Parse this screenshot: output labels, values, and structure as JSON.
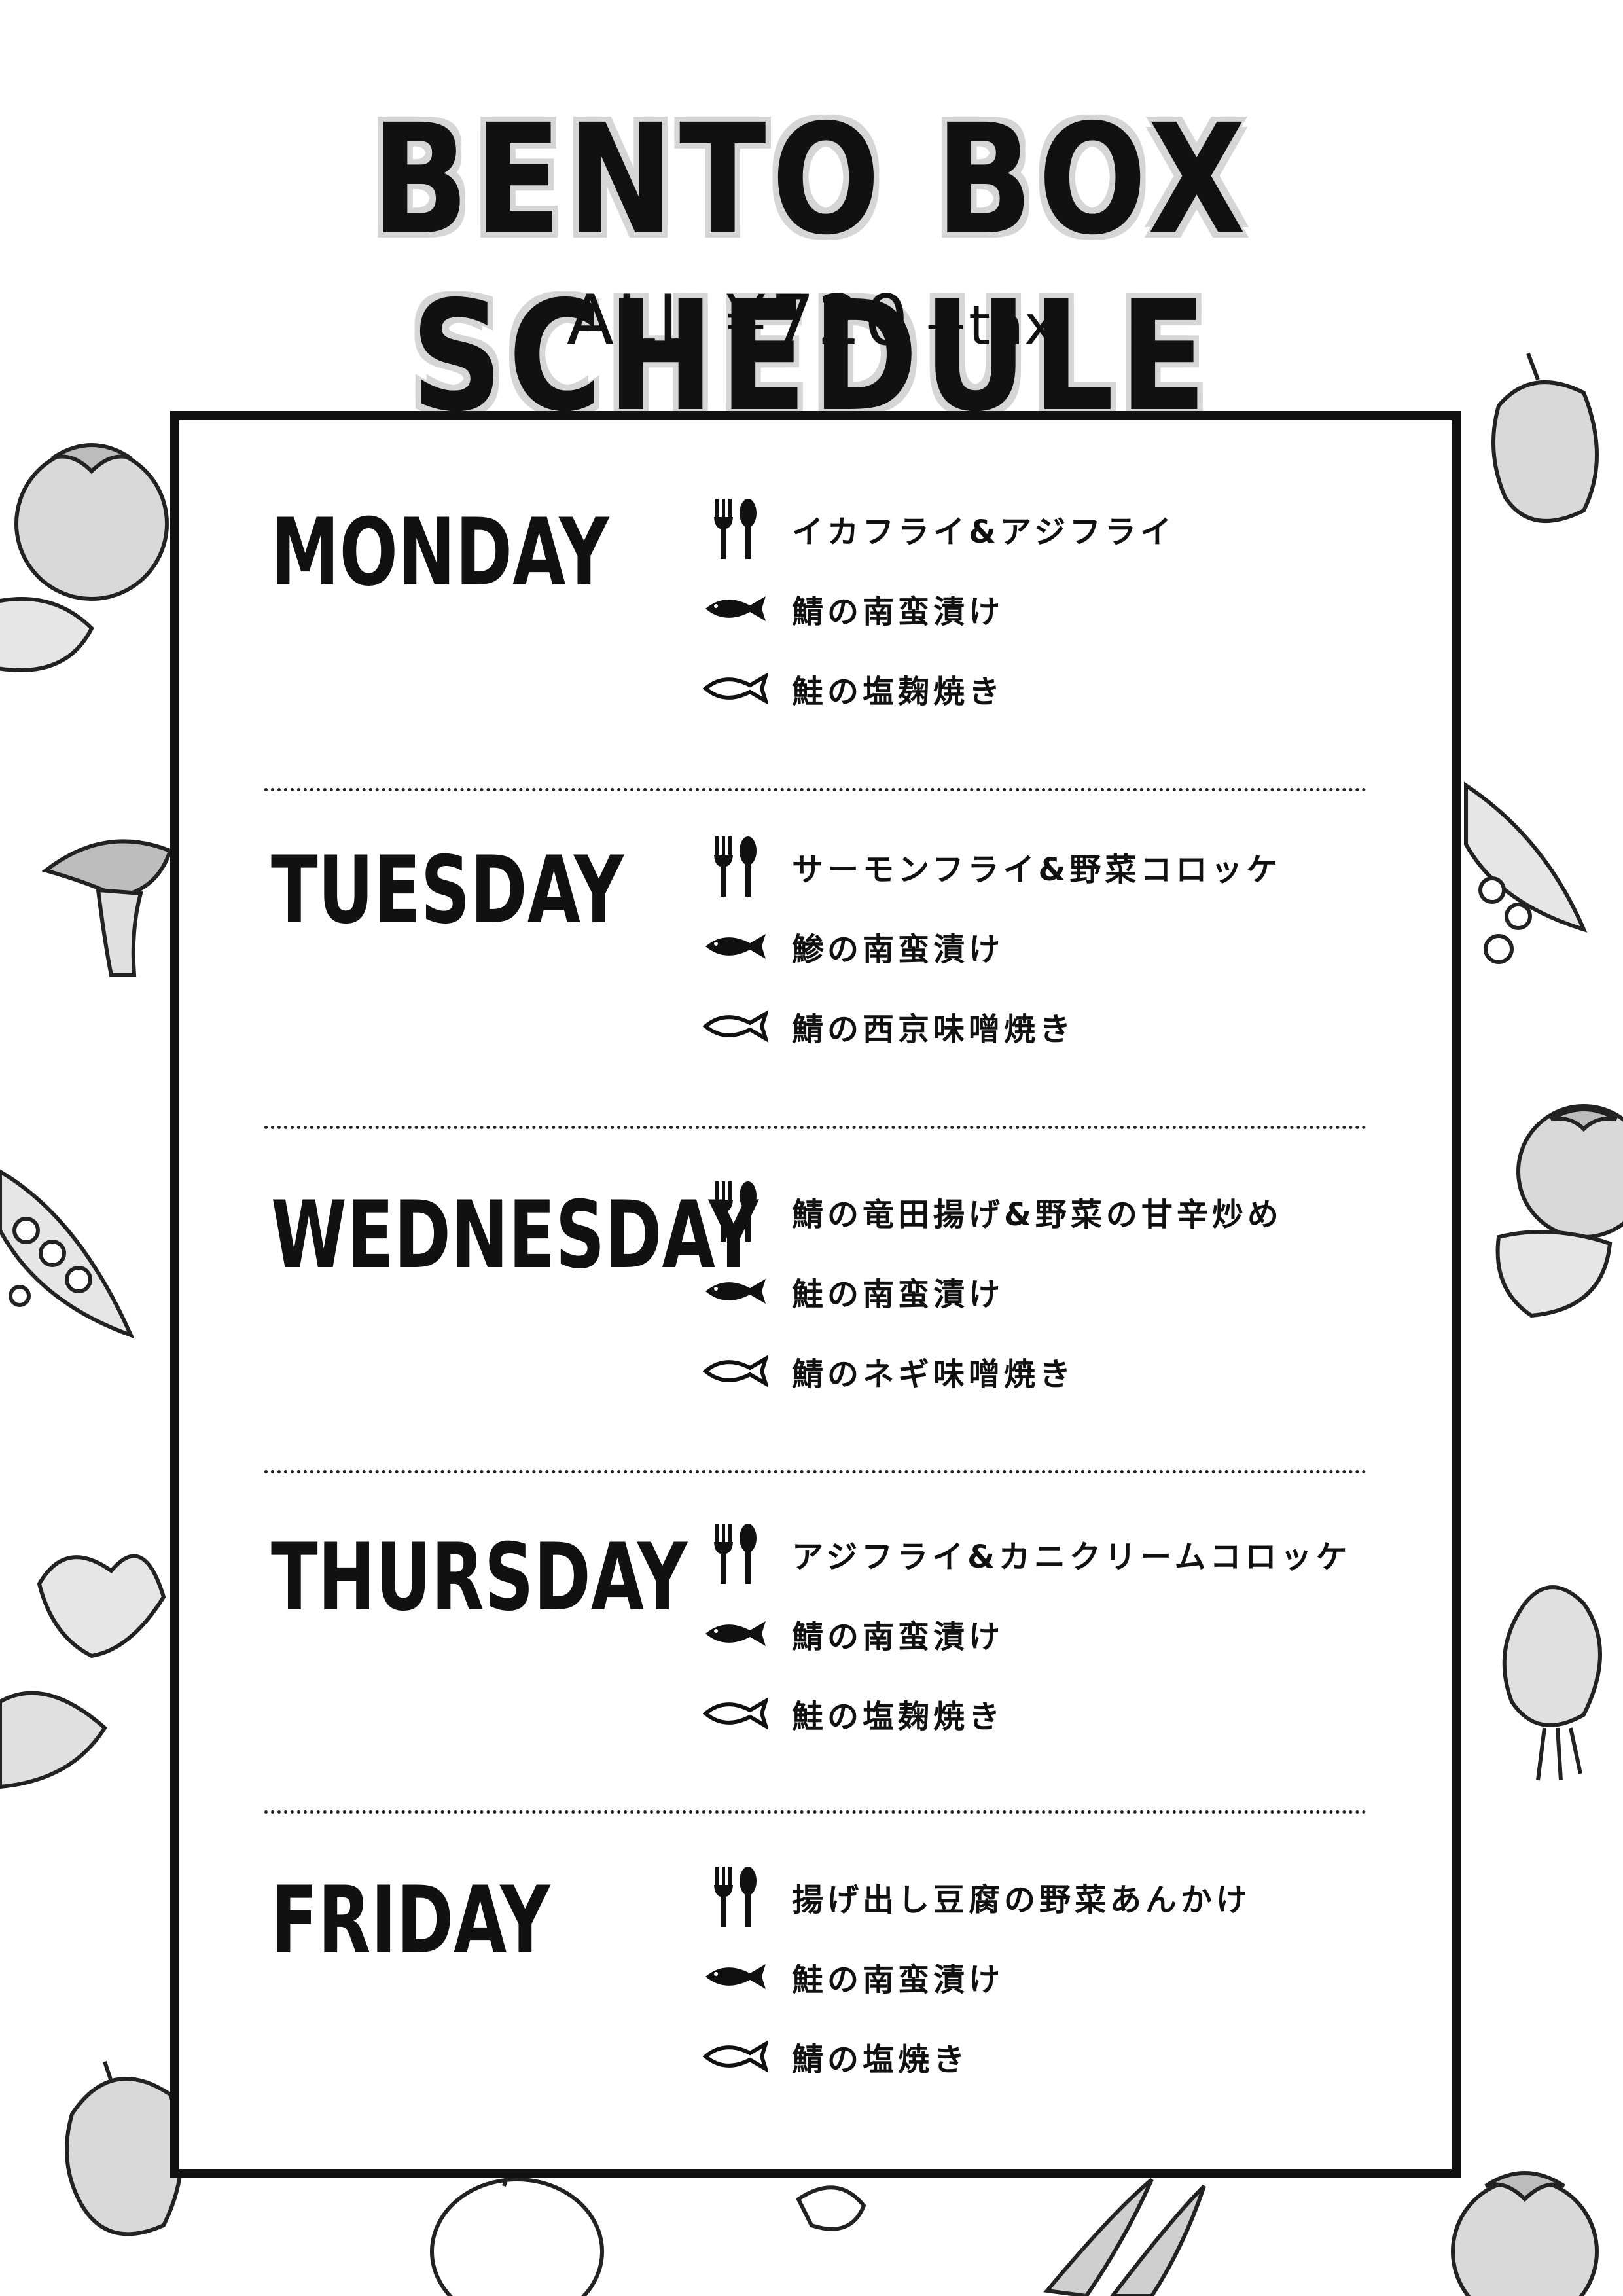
{
  "header": {
    "title": "BENTO BOX SCHEDULE",
    "price": "ALL ¥720",
    "price_suffix": "+tax"
  },
  "schedule": [
    {
      "day": "MONDAY",
      "items": [
        {
          "icon": "cutlery-icon",
          "text": "イカフライ&アジフライ"
        },
        {
          "icon": "fish-filled-icon",
          "text": "鯖の南蛮漬け"
        },
        {
          "icon": "fish-outline-icon",
          "text": "鮭の塩麹焼き"
        }
      ]
    },
    {
      "day": "TUESDAY",
      "items": [
        {
          "icon": "cutlery-icon",
          "text": "サーモンフライ&野菜コロッケ"
        },
        {
          "icon": "fish-filled-icon",
          "text": "鯵の南蛮漬け"
        },
        {
          "icon": "fish-outline-icon",
          "text": "鯖の西京味噌焼き"
        }
      ]
    },
    {
      "day": "WEDNESDAY",
      "items": [
        {
          "icon": "cutlery-icon",
          "text": "鯖の竜田揚げ&野菜の甘辛炒め"
        },
        {
          "icon": "fish-filled-icon",
          "text": "鮭の南蛮漬け"
        },
        {
          "icon": "fish-outline-icon",
          "text": "鯖のネギ味噌焼き"
        }
      ]
    },
    {
      "day": "THURSDAY",
      "items": [
        {
          "icon": "cutlery-icon",
          "text": "アジフライ&カニクリームコロッケ"
        },
        {
          "icon": "fish-filled-icon",
          "text": "鯖の南蛮漬け"
        },
        {
          "icon": "fish-outline-icon",
          "text": "鮭の塩麹焼き"
        }
      ]
    },
    {
      "day": "FRIDAY",
      "items": [
        {
          "icon": "cutlery-icon",
          "text": "揚げ出し豆腐の野菜あんかけ"
        },
        {
          "icon": "fish-filled-icon",
          "text": "鮭の南蛮漬け"
        },
        {
          "icon": "fish-outline-icon",
          "text": "鯖の塩焼き"
        }
      ]
    }
  ],
  "decorations": [
    "tomato-illustration",
    "pumpkin-slice-illustration",
    "mushroom-illustration",
    "pea-pod-illustration",
    "turnip-illustration",
    "bell-pepper-illustration",
    "onion-illustration",
    "carrot-illustration",
    "pumpkin-illustration"
  ]
}
